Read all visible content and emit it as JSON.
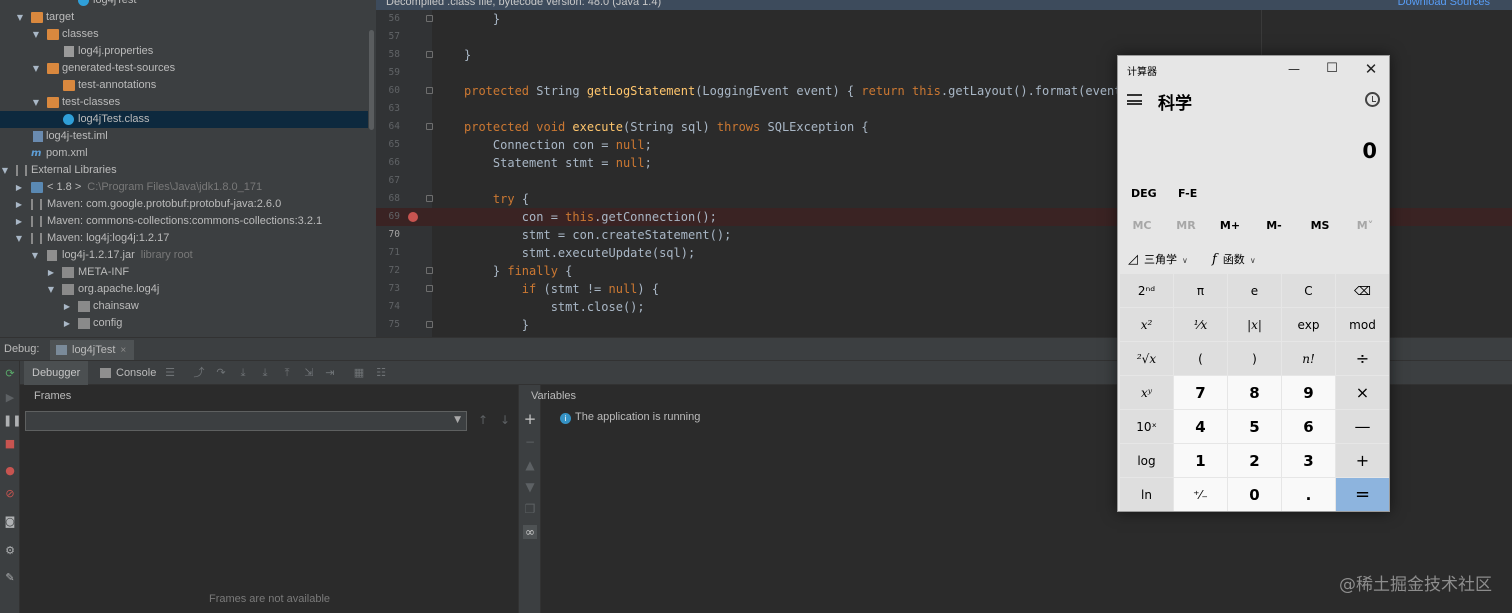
{
  "project_tree": {
    "rows": [
      {
        "label": "log4jTest",
        "hint": ""
      },
      {
        "label": "target",
        "hint": ""
      },
      {
        "label": "classes",
        "hint": ""
      },
      {
        "label": "log4j.properties",
        "hint": ""
      },
      {
        "label": "generated-test-sources",
        "hint": ""
      },
      {
        "label": "test-annotations",
        "hint": ""
      },
      {
        "label": "test-classes",
        "hint": ""
      },
      {
        "label": "log4jTest.class",
        "hint": ""
      },
      {
        "label": "log4j-test.iml",
        "hint": ""
      },
      {
        "label": "pom.xml",
        "hint": ""
      },
      {
        "label": "External Libraries",
        "hint": ""
      },
      {
        "label": "< 1.8 >",
        "hint": "C:\\Program Files\\Java\\jdk1.8.0_171"
      },
      {
        "label": "Maven: com.google.protobuf:protobuf-java:2.6.0",
        "hint": ""
      },
      {
        "label": "Maven: commons-collections:commons-collections:3.2.1",
        "hint": ""
      },
      {
        "label": "Maven: log4j:log4j:1.2.17",
        "hint": ""
      },
      {
        "label": "log4j-1.2.17.jar",
        "hint": "library root"
      },
      {
        "label": "META-INF",
        "hint": ""
      },
      {
        "label": "org.apache.log4j",
        "hint": ""
      },
      {
        "label": "chainsaw",
        "hint": ""
      },
      {
        "label": "config",
        "hint": ""
      }
    ]
  },
  "editor": {
    "banner_text": "Decompiled .class file, bytecode version: 48.0 (Java 1.4)",
    "banner_link": "Download Sources",
    "lines": [
      {
        "num": "56",
        "code": "    }"
      },
      {
        "num": "57",
        "code": ""
      },
      {
        "num": "58",
        "code": "}"
      },
      {
        "num": "59",
        "code": ""
      },
      {
        "num": "60",
        "code": "protected String getLogStatement(LoggingEvent event) { return this.getLayout().format(event); }"
      },
      {
        "num": "63",
        "code": ""
      },
      {
        "num": "64",
        "code": "protected void execute(String sql) throws SQLException {"
      },
      {
        "num": "65",
        "code": "    Connection con = null;"
      },
      {
        "num": "66",
        "code": "    Statement stmt = null;"
      },
      {
        "num": "67",
        "code": ""
      },
      {
        "num": "68",
        "code": "    try {"
      },
      {
        "num": "69",
        "code": "        con = this.getConnection();"
      },
      {
        "num": "70",
        "code": "        stmt = con.createStatement();"
      },
      {
        "num": "71",
        "code": "        stmt.executeUpdate(sql);"
      },
      {
        "num": "72",
        "code": "    } finally {"
      },
      {
        "num": "73",
        "code": "        if (stmt != null) {"
      },
      {
        "num": "74",
        "code": "            stmt.close();"
      },
      {
        "num": "75",
        "code": "        }"
      }
    ]
  },
  "debug": {
    "label": "Debug:",
    "tab_label": "log4jTest",
    "tab_close": "×",
    "debugger_tab": "Debugger",
    "console_tab": "Console",
    "frames_title": "Frames",
    "frames_empty": "Frames are not available",
    "variables_title": "Variables",
    "running_message": "The application is running"
  },
  "calculator": {
    "title": "计算器",
    "mode": "科学",
    "display": "0",
    "angle_mode": "DEG",
    "fe_label": "F-E",
    "memory": [
      "MC",
      "MR",
      "M+",
      "M-",
      "MS",
      "M˅"
    ],
    "trig_menu": "三角学",
    "func_menu": "函数",
    "keys": [
      [
        "2ⁿᵈ",
        "π",
        "e",
        "C",
        "⌫"
      ],
      [
        "x²",
        "¹⁄x",
        "|x|",
        "exp",
        "mod"
      ],
      [
        "²√x",
        "(",
        ")",
        "n!",
        "÷"
      ],
      [
        "xʸ",
        "7",
        "8",
        "9",
        "×"
      ],
      [
        "10ˣ",
        "4",
        "5",
        "6",
        "—"
      ],
      [
        "log",
        "1",
        "2",
        "3",
        "+"
      ],
      [
        "ln",
        "⁺⁄₋",
        "0",
        ".",
        "="
      ]
    ]
  },
  "watermark": "@稀土掘金技术社区"
}
